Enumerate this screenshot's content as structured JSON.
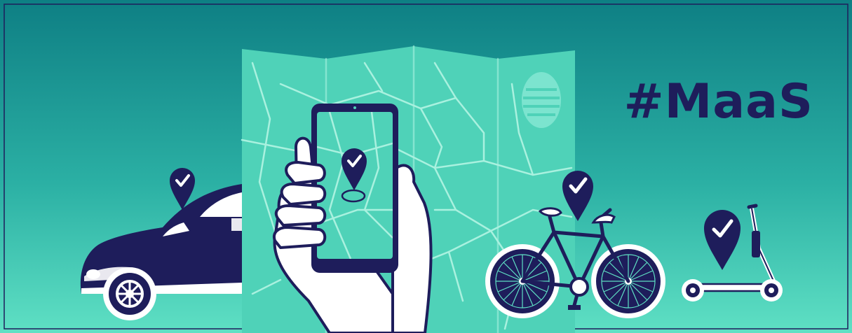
{
  "banner": {
    "hashtag": "#MaaS"
  },
  "colors": {
    "background_top": "#0E7F84",
    "background_bottom": "#5FE0C4",
    "navy": "#1E1D5B",
    "map_fill": "#4FD2B8",
    "map_lines": "#A9F1DF",
    "white": "#FFFFFF"
  },
  "icons": [
    "car-icon",
    "phone-icon",
    "hand-icon",
    "folded-map-icon",
    "bicycle-icon",
    "kick-scooter-icon",
    "location-pin-check-icon"
  ]
}
